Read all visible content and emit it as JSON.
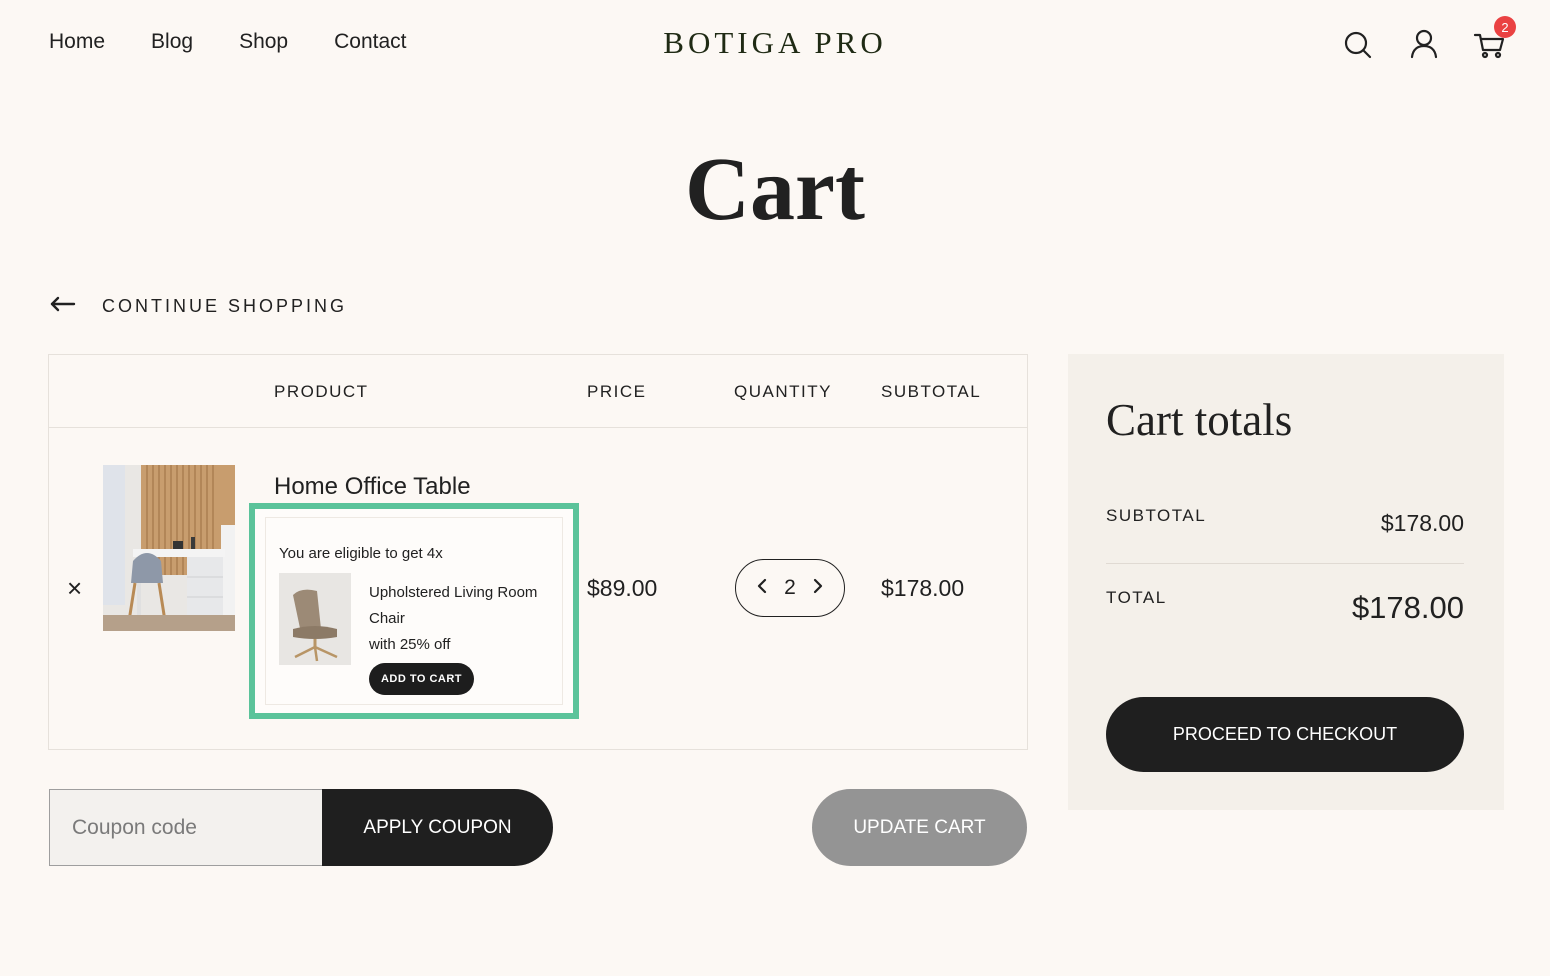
{
  "nav": {
    "items": [
      "Home",
      "Blog",
      "Shop",
      "Contact"
    ]
  },
  "logo": "BOTIGA PRO",
  "header_icons": {
    "search": "search-icon",
    "account": "user-icon",
    "cart": "cart-icon",
    "cart_count": "2"
  },
  "page_title": "Cart",
  "continue_shopping": "CONTINUE SHOPPING",
  "table": {
    "headers": [
      "PRODUCT",
      "PRICE",
      "QUANTITY",
      "SUBTOTAL"
    ],
    "rows": [
      {
        "remove": "×",
        "name": "Home Office Table",
        "price": "$89.00",
        "quantity": "2",
        "subtotal": "$178.00"
      }
    ]
  },
  "upsell": {
    "eligible": "You are eligible to get 4x",
    "product_name": "Upholstered Living Room Chair",
    "discount": "with 25% off",
    "button": "ADD TO CART",
    "border_color": "#5bc39a"
  },
  "coupon": {
    "placeholder": "Coupon code",
    "apply": "APPLY COUPON",
    "update": "UPDATE CART"
  },
  "totals": {
    "title": "Cart totals",
    "subtotal_label": "SUBTOTAL",
    "subtotal_value": "$178.00",
    "total_label": "TOTAL",
    "total_value": "$178.00",
    "checkout": "PROCEED TO CHECKOUT"
  },
  "colors": {
    "background": "#fcf8f4",
    "dark_button": "#1f1f1f",
    "muted_button": "#949494",
    "badge": "#ea4242"
  }
}
